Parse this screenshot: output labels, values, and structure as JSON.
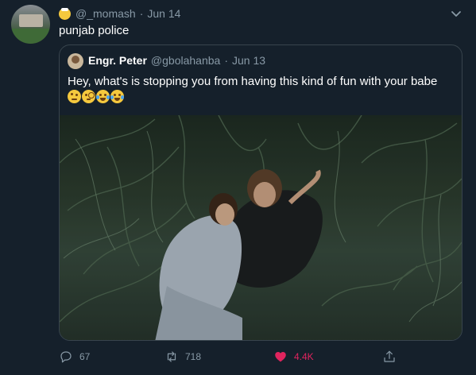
{
  "tweet": {
    "handle": "@_momash",
    "date": "Jun 14",
    "text": "punjab police",
    "avatar_icon": "profile-photo"
  },
  "quoted_tweet": {
    "name": "Engr. Peter",
    "handle": "@gbolahanba",
    "date": "Jun 13",
    "text": "Hey, what's is stopping you from having this kind of fun with your babe",
    "emojis": [
      "face-with-raised-eyebrow",
      "face-with-monocle",
      "face-with-tears-of-joy",
      "face-with-tears-of-joy"
    ],
    "media": "photo"
  },
  "actions": {
    "reply_count": "67",
    "retweet_count": "718",
    "like_count": "4.4K"
  },
  "colors": {
    "background": "#15202b",
    "secondary_text": "#8899a6",
    "border": "#38444d",
    "like": "#e0245e"
  }
}
